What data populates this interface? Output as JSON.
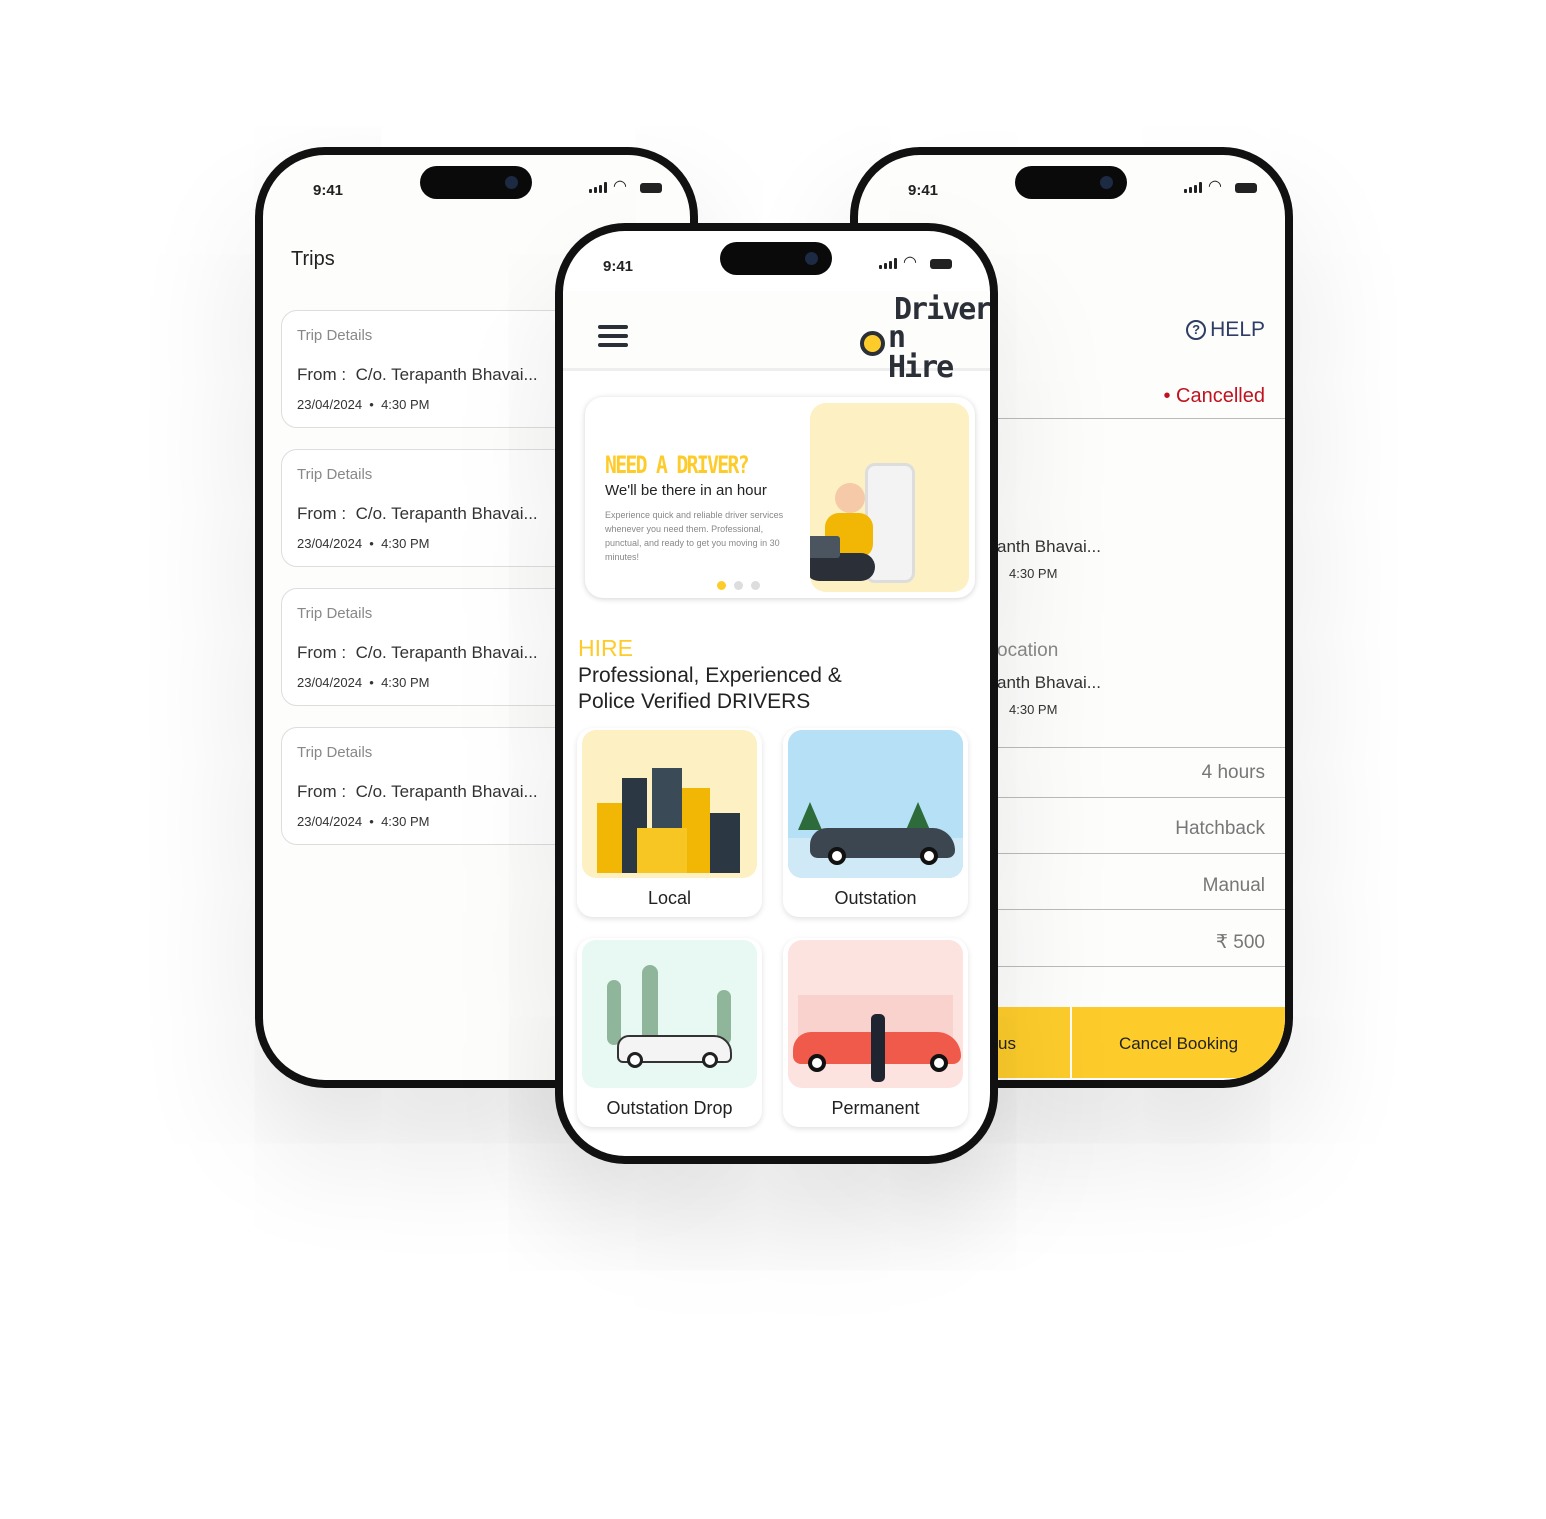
{
  "status_time": "9:41",
  "colors": {
    "accent": "#fdcc2b",
    "cancelled": "#c0121f",
    "help": "#2f3d66"
  },
  "trips": {
    "title": "Trips",
    "cards": [
      {
        "label": "Trip Details",
        "from_label": "From :",
        "from": "C/o. Terapanth Bhavai...",
        "date": "23/04/2024",
        "time": "4:30 PM"
      },
      {
        "label": "Trip Details",
        "from_label": "From :",
        "from": "C/o. Terapanth Bhavai...",
        "date": "23/04/2024",
        "time": "4:30 PM"
      },
      {
        "label": "Trip Details",
        "from_label": "From :",
        "from": "C/o. Terapanth Bhavai...",
        "date": "23/04/2024",
        "time": "4:30 PM"
      },
      {
        "label": "Trip Details",
        "from_label": "From :",
        "from": "C/o. Terapanth Bhavai...",
        "date": "23/04/2024",
        "time": "4:30 PM"
      }
    ]
  },
  "booking": {
    "help": "HELP",
    "status": "Cancelled",
    "pickup_address": "anth Bhavai...",
    "pickup_time": "4:30 PM",
    "drop_label": "ocation",
    "drop_address": "anth Bhavai...",
    "drop_time": "4:30 PM",
    "duration": "4 hours",
    "car_type": "Hatchback",
    "transmission": "Manual",
    "price": "₹ 500",
    "left_button": "us",
    "cancel_button": "Cancel Booking"
  },
  "home": {
    "logo": "Driver On Hire",
    "banner": {
      "headline": "NEED A DRIVER?",
      "subhead": "We'll be there in an hour",
      "body": "Experience quick and reliable driver services whenever you need them. Professional, punctual, and ready to get you moving in 30 minutes!",
      "active_slide": 1,
      "slides": 3
    },
    "hire_title": "HIRE",
    "hire_line1": "Professional, Experienced &",
    "hire_line2": "Police Verified DRIVERS",
    "services": [
      {
        "label": "Local"
      },
      {
        "label": "Outstation"
      },
      {
        "label": "Outstation Drop"
      },
      {
        "label": "Permanent"
      }
    ]
  }
}
